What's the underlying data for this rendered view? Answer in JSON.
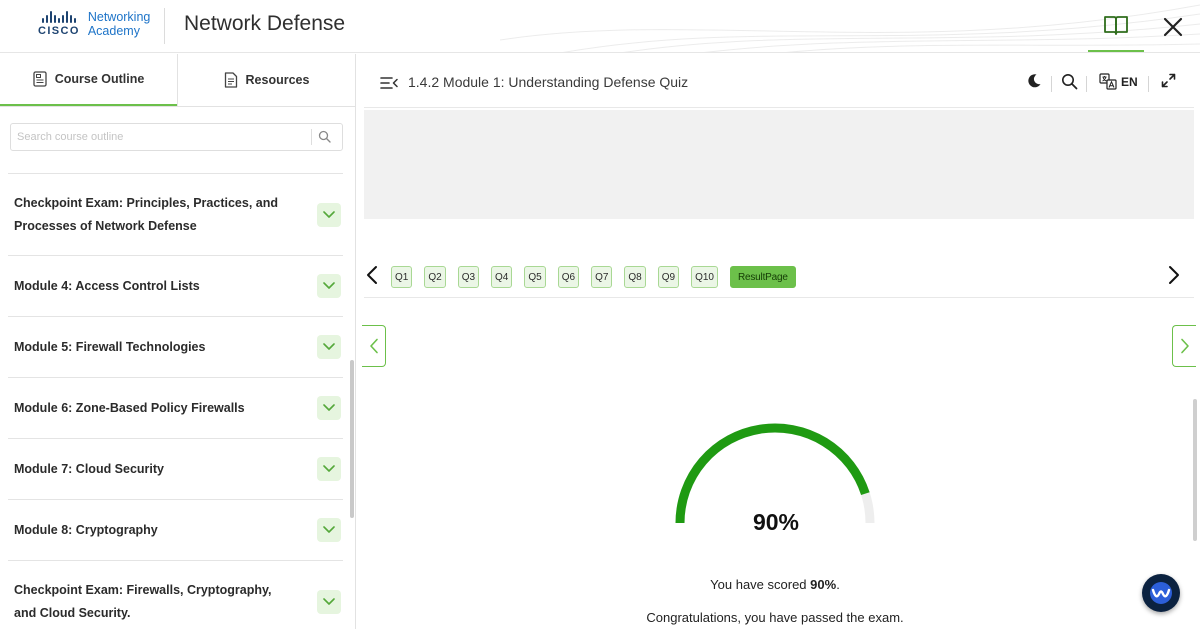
{
  "header": {
    "logo_word": "CISCO",
    "logo_line1": "Networking",
    "logo_line2": "Academy",
    "app_title": "Network Defense",
    "icons": {
      "book": "open-book-icon",
      "close": "close-icon"
    }
  },
  "sidebar": {
    "tabs": [
      {
        "label": "Course Outline",
        "icon": "outline-icon",
        "active": true
      },
      {
        "label": "Resources",
        "icon": "document-icon",
        "active": false
      }
    ],
    "search_placeholder": "Search course outline",
    "items": [
      {
        "label": "Checkpoint Exam: Principles, Practices, and Processes of Network Defense"
      },
      {
        "label": "Module 4: Access Control Lists"
      },
      {
        "label": "Module 5: Firewall Technologies"
      },
      {
        "label": "Module 6: Zone-Based Policy Firewalls"
      },
      {
        "label": "Module 7: Cloud Security"
      },
      {
        "label": "Module 8: Cryptography"
      },
      {
        "label": "Checkpoint Exam: Firewalls, Cryptography, and Cloud Security."
      }
    ]
  },
  "content": {
    "page_title": "1.4.2 Module 1: Understanding Defense Quiz",
    "language": "EN",
    "questions": [
      "Q1",
      "Q2",
      "Q3",
      "Q4",
      "Q5",
      "Q6",
      "Q7",
      "Q8",
      "Q9",
      "Q10"
    ],
    "result_page_label": "ResultPage",
    "score": {
      "percent": 90,
      "display": "90%",
      "text_prefix": "You have scored ",
      "text_value": "90%",
      "text_suffix": "."
    },
    "congrats": "Congratulations, you have passed the exam."
  },
  "colors": {
    "accent_green": "#6cc04a",
    "gauge_green": "#1f9a12",
    "gauge_track": "#eeeeee",
    "cisco_blue": "#1e4471",
    "academy_blue": "#1e74c8"
  }
}
